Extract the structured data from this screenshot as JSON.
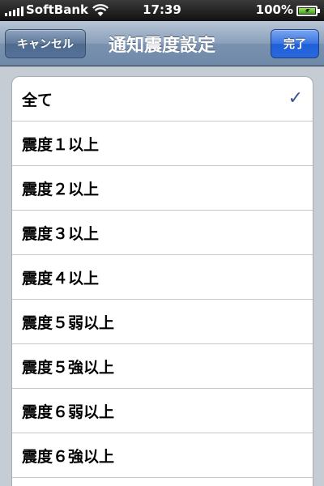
{
  "status_bar": {
    "carrier": "SoftBank",
    "time": "17:39",
    "battery": "100%"
  },
  "nav": {
    "title": "通知震度設定",
    "cancel_label": "キャンセル",
    "done_label": "完了"
  },
  "list": {
    "items": [
      {
        "label": "全て",
        "checked": true
      },
      {
        "label": "震度１以上",
        "checked": false
      },
      {
        "label": "震度２以上",
        "checked": false
      },
      {
        "label": "震度３以上",
        "checked": false
      },
      {
        "label": "震度４以上",
        "checked": false
      },
      {
        "label": "震度５弱以上",
        "checked": false
      },
      {
        "label": "震度５強以上",
        "checked": false
      },
      {
        "label": "震度６弱以上",
        "checked": false
      },
      {
        "label": "震度６強以上",
        "checked": false
      }
    ],
    "check_glyph": "✓"
  }
}
